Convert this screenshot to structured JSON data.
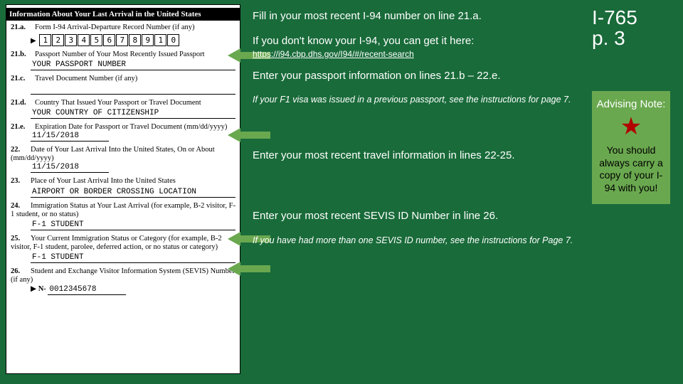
{
  "form": {
    "headerTitle": "Information About Your Last Arrival in the United States",
    "r21a": {
      "num": "21.a.",
      "label": "Form I-94 Arrival-Departure Record Number (if any)",
      "digits": [
        "1",
        "2",
        "3",
        "4",
        "5",
        "6",
        "7",
        "8",
        "9",
        "1",
        "0"
      ]
    },
    "r21b": {
      "num": "21.b.",
      "label": "Passport Number of Your Most Recently Issued Passport",
      "value": "YOUR PASSPORT NUMBER"
    },
    "r21c": {
      "num": "21.c.",
      "label": "Travel Document Number (if any)",
      "value": ""
    },
    "r21d": {
      "num": "21.d.",
      "label": "Country That Issued Your Passport or Travel Document",
      "value": "YOUR COUNTRY OF CITIZENSHIP"
    },
    "r21e": {
      "num": "21.e.",
      "label": "Expiration Date for Passport or Travel Document (mm/dd/yyyy)",
      "value": "11/15/2018"
    },
    "r22": {
      "num": "22.",
      "label": "Date of Your Last Arrival Into the United States, On or About (mm/dd/yyyy)",
      "value": "11/15/2018"
    },
    "r23": {
      "num": "23.",
      "label": "Place of Your Last Arrival Into the United States",
      "value": "AIRPORT OR BORDER CROSSING LOCATION"
    },
    "r24": {
      "num": "24.",
      "label": "Immigration Status at Your Last Arrival (for example, B-2 visitor, F-1 student, or no status)",
      "value": "F-1 STUDENT"
    },
    "r25": {
      "num": "25.",
      "label": "Your Current Immigration Status or Category (for example, B-2 visitor, F-1 student, parolee, deferred action, or no status or category)",
      "value": "F-1 STUDENT"
    },
    "r26": {
      "num": "26.",
      "label": "Student and Exchange Visitor Information System (SEVIS) Number (if any)",
      "prefix": "N-",
      "value": "0012345678"
    }
  },
  "instructions": {
    "b1": "Fill in your most recent I-94 number on line 21.a.",
    "b2a": "If you don't know your I-94, you can get it here: ",
    "b2link": "https://i94.cbp.dhs.gov/I94/#/recent-search",
    "b3": "Enter your passport information on lines 21.b – 22.e.",
    "n1": "If your F1 visa was issued in a previous passport, see the instructions for page 7.",
    "b4": "Enter your most recent travel information in lines 22-25.",
    "b5": "Enter your most recent SEVIS ID Number in line 26.",
    "n2": "If you have had more than one SEVIS ID number, see the instructions for Page 7."
  },
  "sidebar": {
    "title1": "I-765",
    "title2": "p. 3",
    "noteTitle": "Advising Note:",
    "noteBody": "You should always carry a copy of your I-94 with you!"
  }
}
